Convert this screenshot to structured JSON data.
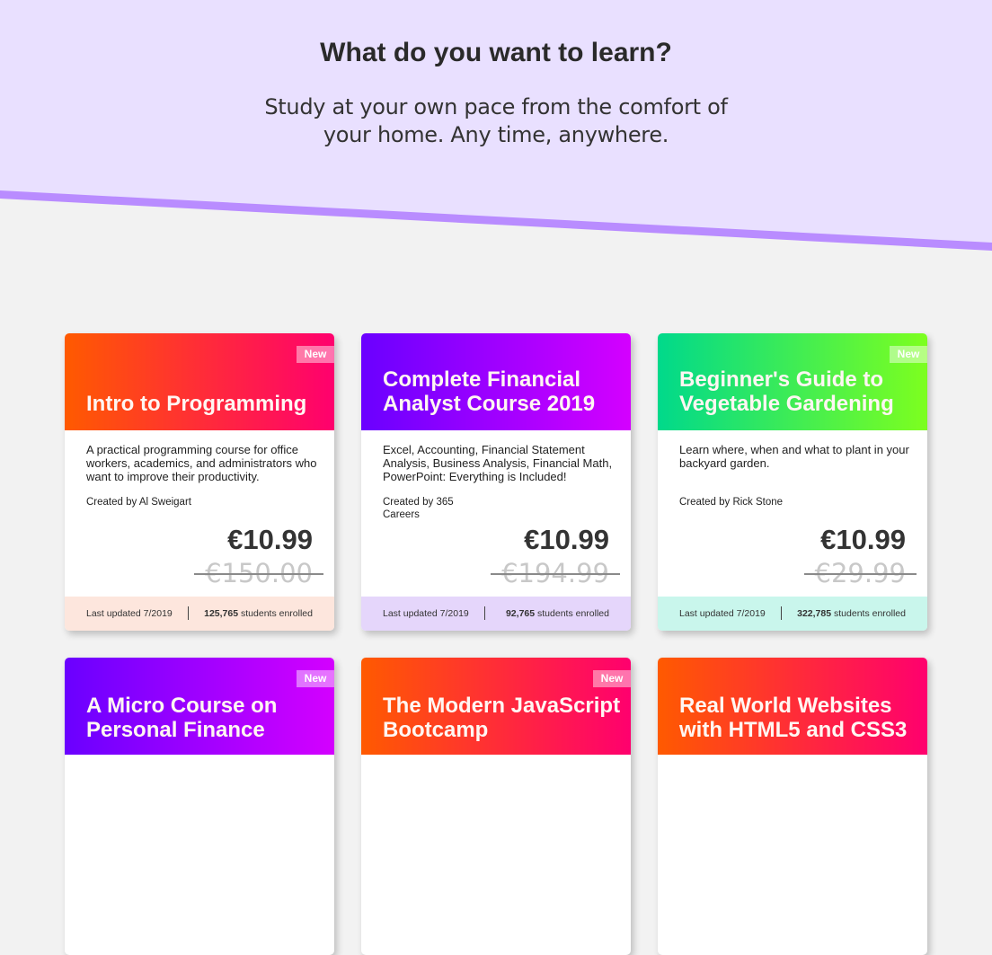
{
  "hero": {
    "title": "What do you want to learn?",
    "subtitle": "Study at your own pace from the comfort of your home. Any time, anywhere.",
    "bg_color": "#e9e0ff",
    "stripe_color": "#b98cff"
  },
  "courses": [
    {
      "title": "Intro to Programming",
      "badge": "New",
      "description": "A practical programming course for office workers, academics, and administrators who want to improve their productivity.",
      "author": "Created by Al Sweigart",
      "price": "€10.99",
      "old_price": "€150.00",
      "updated": "Last updated 7/2019",
      "students_count": "125,765",
      "students_label": "students enrolled",
      "gradient": [
        "#ff5a00",
        "#ff006e"
      ],
      "foot_color": "#fde6dd"
    },
    {
      "title": "Complete Financial Analyst Course 2019",
      "badge": "",
      "description": "Excel, Accounting, Financial Statement Analysis, Business Analysis, Financial Math, PowerPoint: Everything is Included!",
      "author": "Created by 365 Careers",
      "price": "€10.99",
      "old_price": "€194.99",
      "updated": "Last updated 7/2019",
      "students_count": "92,765",
      "students_label": "students enrolled",
      "gradient": [
        "#6a00ff",
        "#d400ff"
      ],
      "foot_color": "#e5d6fb"
    },
    {
      "title": "Beginner's Guide to Vegetable Gardening",
      "badge": "New",
      "description": "Learn where, when and what to plant in your backyard garden.",
      "author": "Created by Rick Stone",
      "price": "€10.99",
      "old_price": "€29.99",
      "updated": "Last updated 7/2019",
      "students_count": "322,785",
      "students_label": "students enrolled",
      "gradient": [
        "#00d98b",
        "#7dff1f"
      ],
      "foot_color": "#c9f6ec"
    },
    {
      "title": "A Micro Course on Personal Finance",
      "badge": "New",
      "gradient": [
        "#6a00ff",
        "#d400ff"
      ]
    },
    {
      "title": "The Modern JavaScript Bootcamp",
      "badge": "New",
      "gradient": [
        "#ff5a00",
        "#ff006e"
      ]
    },
    {
      "title": "Real World Websites with HTML5 and CSS3",
      "badge": "",
      "gradient": [
        "#ff5a00",
        "#ff006e"
      ]
    }
  ]
}
